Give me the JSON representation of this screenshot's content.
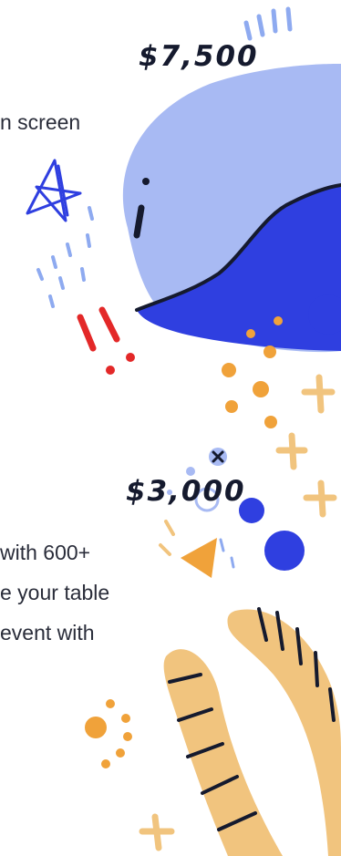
{
  "tier_top": {
    "price": "$7,500",
    "description_lines": [
      "n screen"
    ]
  },
  "tier_mid": {
    "price": "$3,000",
    "description_lines": [
      "with 600+",
      "e your table",
      "event with"
    ]
  },
  "colors": {
    "light_blue": "#a8baf3",
    "royal_blue": "#2f3fe0",
    "orange": "#f0a23a",
    "tan": "#f1c47e",
    "red": "#e32828",
    "ink": "#151a2e"
  },
  "decor": {
    "illustration": "doodle-illustration"
  }
}
